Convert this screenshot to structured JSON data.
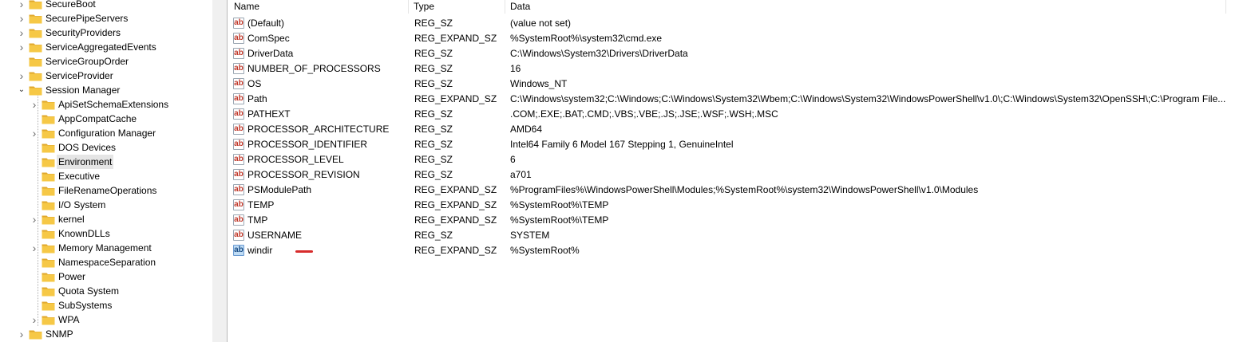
{
  "tree": {
    "items": [
      {
        "label": "SecureBoot",
        "level": 0,
        "expander": "collapsed"
      },
      {
        "label": "SecurePipeServers",
        "level": 0,
        "expander": "collapsed"
      },
      {
        "label": "SecurityProviders",
        "level": 0,
        "expander": "collapsed"
      },
      {
        "label": "ServiceAggregatedEvents",
        "level": 0,
        "expander": "collapsed"
      },
      {
        "label": "ServiceGroupOrder",
        "level": 0,
        "expander": "none"
      },
      {
        "label": "ServiceProvider",
        "level": 0,
        "expander": "collapsed"
      },
      {
        "label": "Session Manager",
        "level": 0,
        "expander": "expanded"
      },
      {
        "label": "ApiSetSchemaExtensions",
        "level": 1,
        "expander": "collapsed"
      },
      {
        "label": "AppCompatCache",
        "level": 1,
        "expander": "none"
      },
      {
        "label": "Configuration Manager",
        "level": 1,
        "expander": "collapsed"
      },
      {
        "label": "DOS Devices",
        "level": 1,
        "expander": "none"
      },
      {
        "label": "Environment",
        "level": 1,
        "expander": "none",
        "selected": true
      },
      {
        "label": "Executive",
        "level": 1,
        "expander": "none"
      },
      {
        "label": "FileRenameOperations",
        "level": 1,
        "expander": "none"
      },
      {
        "label": "I/O System",
        "level": 1,
        "expander": "none"
      },
      {
        "label": "kernel",
        "level": 1,
        "expander": "collapsed"
      },
      {
        "label": "KnownDLLs",
        "level": 1,
        "expander": "none"
      },
      {
        "label": "Memory Management",
        "level": 1,
        "expander": "collapsed"
      },
      {
        "label": "NamespaceSeparation",
        "level": 1,
        "expander": "none"
      },
      {
        "label": "Power",
        "level": 1,
        "expander": "none"
      },
      {
        "label": "Quota System",
        "level": 1,
        "expander": "none"
      },
      {
        "label": "SubSystems",
        "level": 1,
        "expander": "none"
      },
      {
        "label": "WPA",
        "level": 1,
        "expander": "collapsed"
      },
      {
        "label": "SNMP",
        "level": 0,
        "expander": "collapsed"
      }
    ]
  },
  "values": {
    "columns": {
      "name": "Name",
      "type": "Type",
      "data": "Data"
    },
    "rows": [
      {
        "name": "(Default)",
        "type": "REG_SZ",
        "data": "(value not set)"
      },
      {
        "name": "ComSpec",
        "type": "REG_EXPAND_SZ",
        "data": "%SystemRoot%\\system32\\cmd.exe"
      },
      {
        "name": "DriverData",
        "type": "REG_SZ",
        "data": "C:\\Windows\\System32\\Drivers\\DriverData"
      },
      {
        "name": "NUMBER_OF_PROCESSORS",
        "type": "REG_SZ",
        "data": "16"
      },
      {
        "name": "OS",
        "type": "REG_SZ",
        "data": "Windows_NT"
      },
      {
        "name": "Path",
        "type": "REG_EXPAND_SZ",
        "data": "C:\\Windows\\system32;C:\\Windows;C:\\Windows\\System32\\Wbem;C:\\Windows\\System32\\WindowsPowerShell\\v1.0\\;C:\\Windows\\System32\\OpenSSH\\;C:\\Program File..."
      },
      {
        "name": "PATHEXT",
        "type": "REG_SZ",
        "data": ".COM;.EXE;.BAT;.CMD;.VBS;.VBE;.JS;.JSE;.WSF;.WSH;.MSC"
      },
      {
        "name": "PROCESSOR_ARCHITECTURE",
        "type": "REG_SZ",
        "data": "AMD64"
      },
      {
        "name": "PROCESSOR_IDENTIFIER",
        "type": "REG_SZ",
        "data": "Intel64 Family 6 Model 167 Stepping 1, GenuineIntel"
      },
      {
        "name": "PROCESSOR_LEVEL",
        "type": "REG_SZ",
        "data": "6"
      },
      {
        "name": "PROCESSOR_REVISION",
        "type": "REG_SZ",
        "data": "a701"
      },
      {
        "name": "PSModulePath",
        "type": "REG_EXPAND_SZ",
        "data": "%ProgramFiles%\\WindowsPowerShell\\Modules;%SystemRoot%\\system32\\WindowsPowerShell\\v1.0\\Modules"
      },
      {
        "name": "TEMP",
        "type": "REG_EXPAND_SZ",
        "data": "%SystemRoot%\\TEMP"
      },
      {
        "name": "TMP",
        "type": "REG_EXPAND_SZ",
        "data": "%SystemRoot%\\TEMP"
      },
      {
        "name": "USERNAME",
        "type": "REG_SZ",
        "data": "SYSTEM"
      },
      {
        "name": "windir",
        "type": "REG_EXPAND_SZ",
        "data": "%SystemRoot%",
        "selected_icon": true,
        "annotated": true
      }
    ],
    "icon_glyph": "ab"
  },
  "colors": {
    "folder": "#f6c846",
    "folder_dark": "#e0a82e",
    "selected_bg": "#e5e5e5",
    "annotation": "#d72b2b",
    "icon_text": "#c0392b"
  }
}
